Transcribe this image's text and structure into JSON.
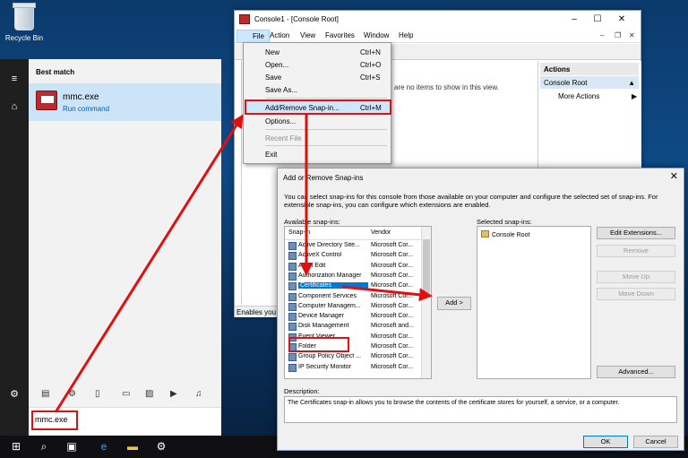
{
  "desktop": {
    "recycle_bin_label": "Recycle Bin"
  },
  "start_menu": {
    "best_match_label": "Best match",
    "match_title": "mmc.exe",
    "match_subtitle": "Run command",
    "search_text": "mmc.exe",
    "filter_icons": [
      "apps-icon",
      "settings-icon",
      "documents-icon",
      "folders-icon",
      "photos-icon",
      "videos-icon",
      "music-icon"
    ],
    "rail_icons": [
      "hamburger-icon",
      "home-icon",
      "settings-icon"
    ]
  },
  "taskbar": {
    "icons": [
      "windows-start-icon",
      "search-icon",
      "task-view-icon",
      "edge-icon",
      "file-explorer-icon",
      "settings-icon"
    ]
  },
  "console": {
    "title": "Console1 - [Console Root]",
    "menu": [
      "File",
      "Action",
      "View",
      "Favorites",
      "Window",
      "Help"
    ],
    "center_message": "are no items to show in this view.",
    "actions_header": "Actions",
    "actions_root": "Console Root",
    "actions_more": "More Actions",
    "status_text": "Enables you t"
  },
  "file_menu": {
    "items": [
      {
        "label": "New",
        "shortcut": "Ctrl+N"
      },
      {
        "label": "Open...",
        "shortcut": "Ctrl+O"
      },
      {
        "label": "Save",
        "shortcut": "Ctrl+S"
      },
      {
        "label": "Save As...",
        "shortcut": ""
      },
      {
        "label": "Add/Remove Snap-in...",
        "shortcut": "Ctrl+M"
      },
      {
        "label": "Options...",
        "shortcut": ""
      },
      {
        "label": "Recent File",
        "shortcut": ""
      },
      {
        "label": "Exit",
        "shortcut": ""
      }
    ]
  },
  "dialog": {
    "title": "Add or Remove Snap-ins",
    "description": "You can select snap-ins for this console from those available on your computer and configure the selected set of snap-ins. For extensible snap-ins, you can configure which extensions are enabled.",
    "available_label": "Available snap-ins:",
    "selected_label": "Selected snap-ins:",
    "col_snapin": "Snap-in",
    "col_vendor": "Vendor",
    "snapins": [
      {
        "name": "Active Directory Site...",
        "vendor": "Microsoft Cor..."
      },
      {
        "name": "ActiveX Control",
        "vendor": "Microsoft Cor..."
      },
      {
        "name": "ADSI Edit",
        "vendor": "Microsoft Cor..."
      },
      {
        "name": "Authorization Manager",
        "vendor": "Microsoft Cor..."
      },
      {
        "name": "Certificates",
        "vendor": "Microsoft Cor..."
      },
      {
        "name": "Component Services",
        "vendor": "Microsoft Cor..."
      },
      {
        "name": "Computer Managem...",
        "vendor": "Microsoft Cor..."
      },
      {
        "name": "Device Manager",
        "vendor": "Microsoft Cor..."
      },
      {
        "name": "Disk Management",
        "vendor": "Microsoft and..."
      },
      {
        "name": "Event Viewer",
        "vendor": "Microsoft Cor..."
      },
      {
        "name": "Folder",
        "vendor": "Microsoft Cor..."
      },
      {
        "name": "Group Policy Object ...",
        "vendor": "Microsoft Cor..."
      },
      {
        "name": "IP Security Monitor",
        "vendor": "Microsoft Cor..."
      }
    ],
    "selected_item": "Console Root",
    "add_button": "Add >",
    "edit_extensions": "Edit Extensions...",
    "remove": "Remove",
    "move_up": "Move Up",
    "move_down": "Move Down",
    "advanced": "Advanced...",
    "description_label": "Description:",
    "description_text": "The Certificates snap-in allows you to browse the contents of the certificate stores for yourself, a service, or a computer.",
    "ok": "OK",
    "cancel": "Cancel"
  },
  "colors": {
    "highlight_red": "#e01010",
    "selection_blue": "#0078d7",
    "start_rail": "#1f1f1f"
  }
}
